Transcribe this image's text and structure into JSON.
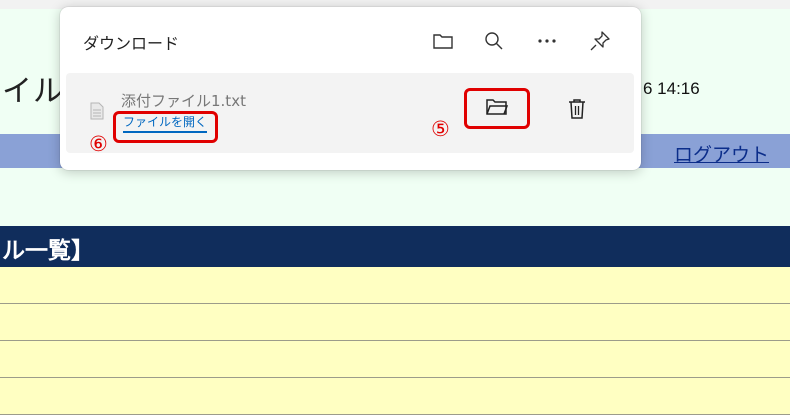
{
  "background_page": {
    "title_fragment": "イル",
    "datetime": "6 14:16",
    "logout_label": "ログアウト",
    "section_title": "ル一覧】"
  },
  "downloads_panel": {
    "title": "ダウンロード",
    "toolbar_icons": [
      "folder-icon",
      "search-icon",
      "more-icon",
      "pin-icon"
    ],
    "item": {
      "file_name": "添付ファイル1.txt",
      "open_file_label": "ファイルを開く",
      "icons": [
        "text-file-icon",
        "open-folder-icon",
        "trash-icon"
      ]
    }
  },
  "annotations": {
    "callout_open_folder": "⑤",
    "callout_open_file": "⑥",
    "highlight_color": "#e00000"
  }
}
